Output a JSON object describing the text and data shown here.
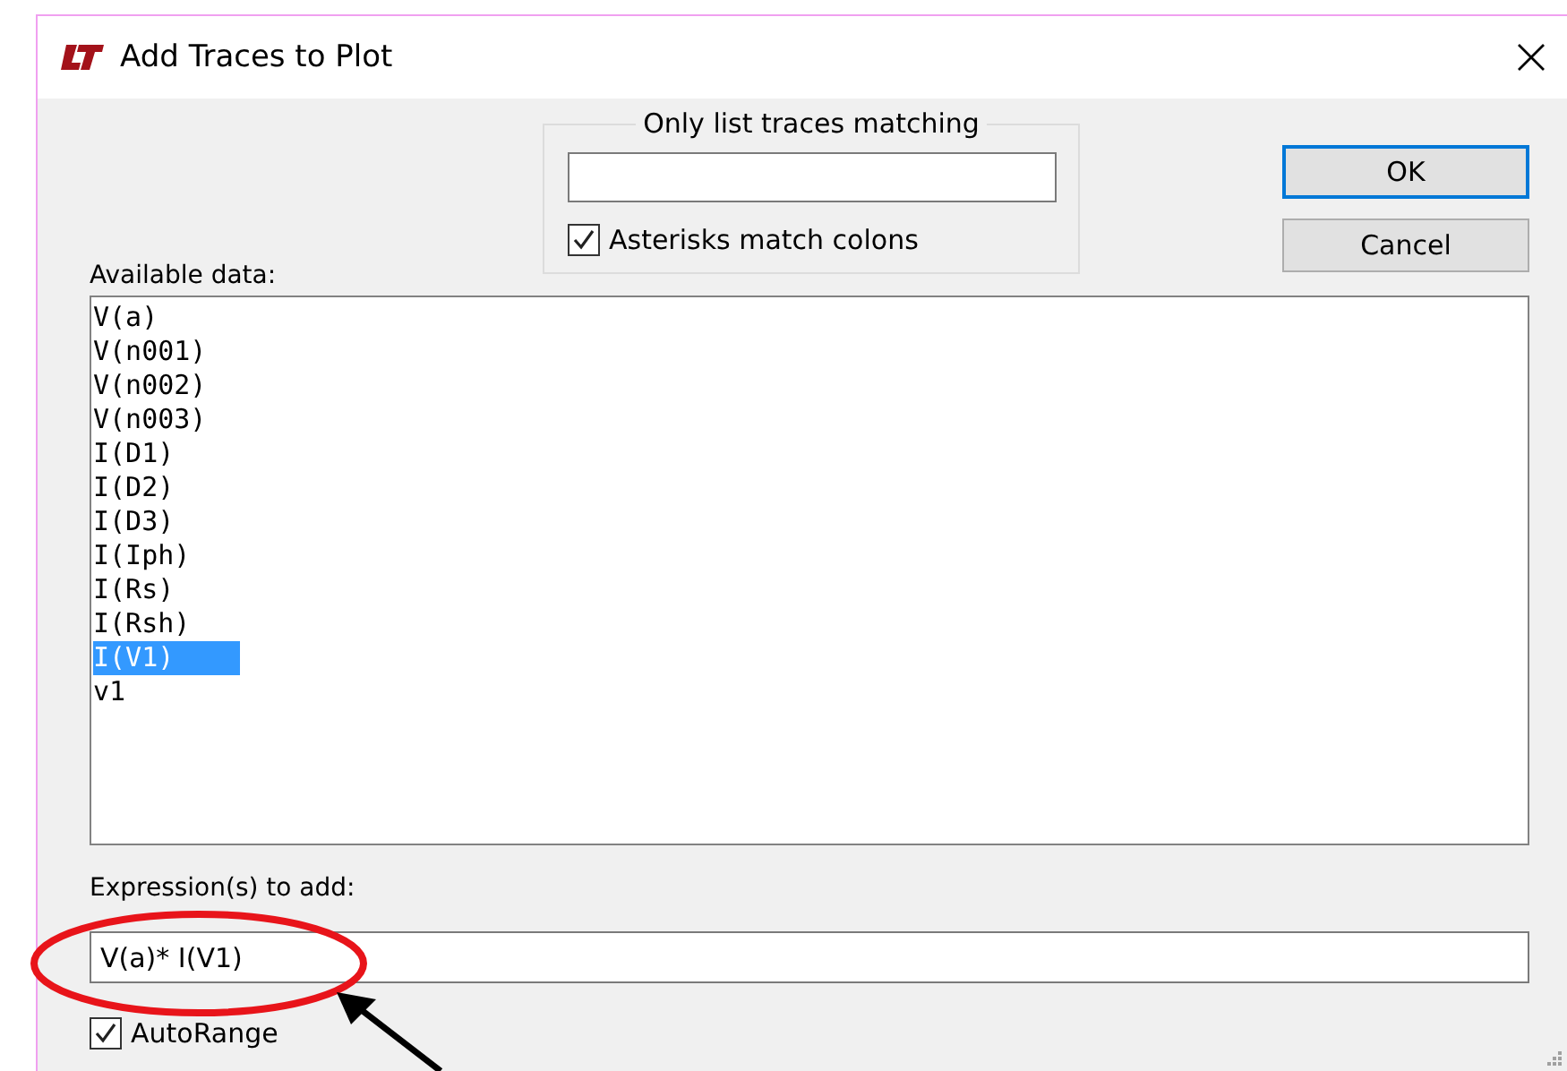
{
  "window": {
    "title": "Add Traces to Plot"
  },
  "filter": {
    "legend": "Only list traces matching",
    "asterisks": {
      "label": "Asterisks match colons",
      "checked": true
    }
  },
  "buttons": [
    {
      "label": "OK",
      "default": true
    },
    {
      "label": "Cancel",
      "default": false
    }
  ],
  "available": {
    "label": "Available data:",
    "items": [
      {
        "text": "V(a)",
        "selected": false
      },
      {
        "text": "V(n001)",
        "selected": false
      },
      {
        "text": "V(n002)",
        "selected": false
      },
      {
        "text": "V(n003)",
        "selected": false
      },
      {
        "text": "I(D1)",
        "selected": false
      },
      {
        "text": "I(D2)",
        "selected": false
      },
      {
        "text": "I(D3)",
        "selected": false
      },
      {
        "text": "I(Iph)",
        "selected": false
      },
      {
        "text": "I(Rs)",
        "selected": false
      },
      {
        "text": "I(Rsh)",
        "selected": false
      },
      {
        "text": "I(V1)",
        "selected": true
      },
      {
        "text": "v1",
        "selected": false
      }
    ]
  },
  "expression": {
    "label": "Expression(s) to add:",
    "value": "V(a)* I(V1)"
  },
  "autorange": {
    "label": "AutoRange",
    "checked": true
  },
  "annotations": [
    {
      "kind": "ellipse"
    },
    {
      "kind": "arrow"
    }
  ]
}
